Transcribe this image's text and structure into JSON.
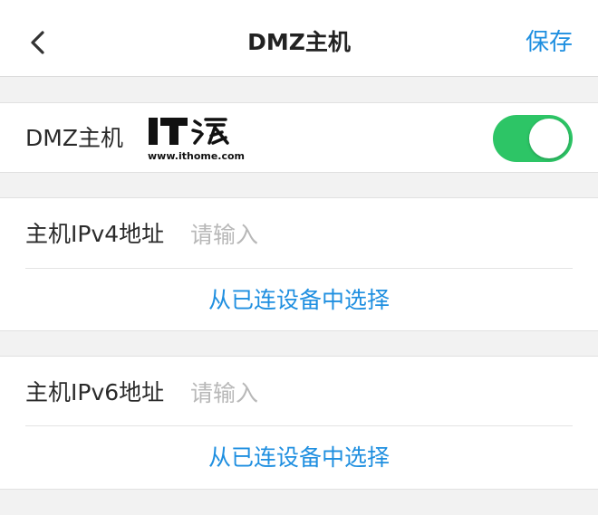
{
  "header": {
    "title": "DMZ主机",
    "save_label": "保存",
    "back_icon": "chevron-left-icon"
  },
  "dmz_toggle": {
    "label": "DMZ主机",
    "state": "on",
    "color_on": "#2dc566"
  },
  "watermark": {
    "logo_text": "IT之家",
    "url": "www.ithome.com"
  },
  "ipv4": {
    "label": "主机IPv4地址",
    "value": "",
    "placeholder": "请输入",
    "select_link": "从已连设备中选择"
  },
  "ipv6": {
    "label": "主机IPv6地址",
    "value": "",
    "placeholder": "请输入",
    "select_link": "从已连设备中选择"
  },
  "colors": {
    "accent": "#1f8fe0",
    "background": "#f2f2f2"
  }
}
